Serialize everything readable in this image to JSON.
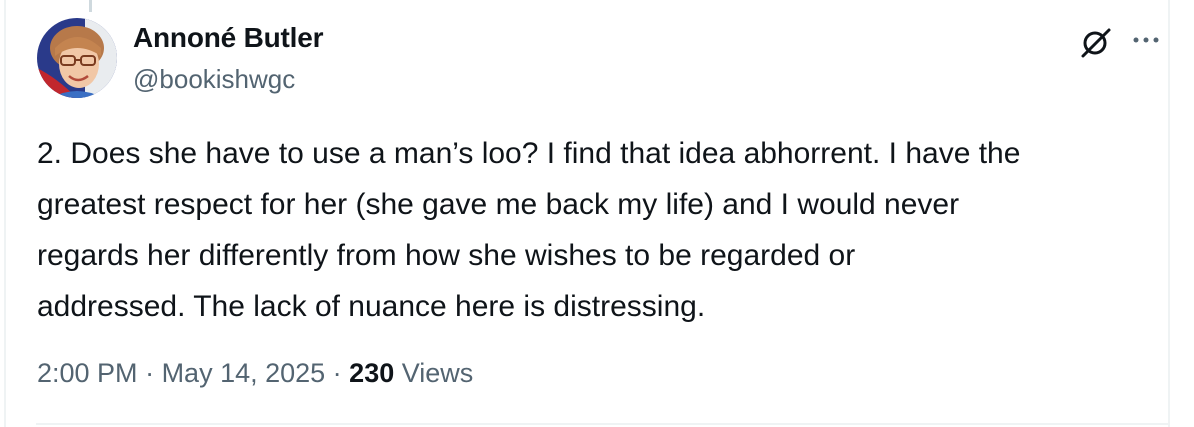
{
  "author": {
    "display_name": "Annoné Butler",
    "handle": "@bookishwgc"
  },
  "icons": {
    "grok": "grok-icon",
    "more": "more-options-icon",
    "avatar": "avatar-photo"
  },
  "tweet": {
    "text": "2. Does she have to use a man’s loo? I find that idea abhorrent. I have the\ngreatest respect for her (she gave me back my life) and I would never\nregards her differently from how she wishes to be regarded or\naddressed. The lack of nuance here is distressing."
  },
  "meta": {
    "time": "2:00 PM",
    "separator": " · ",
    "date": "May 14, 2025",
    "views_count": "230",
    "views_label": " Views"
  },
  "colors": {
    "text_primary": "#0f1419",
    "text_secondary": "#536471",
    "border": "#eff3f4"
  }
}
